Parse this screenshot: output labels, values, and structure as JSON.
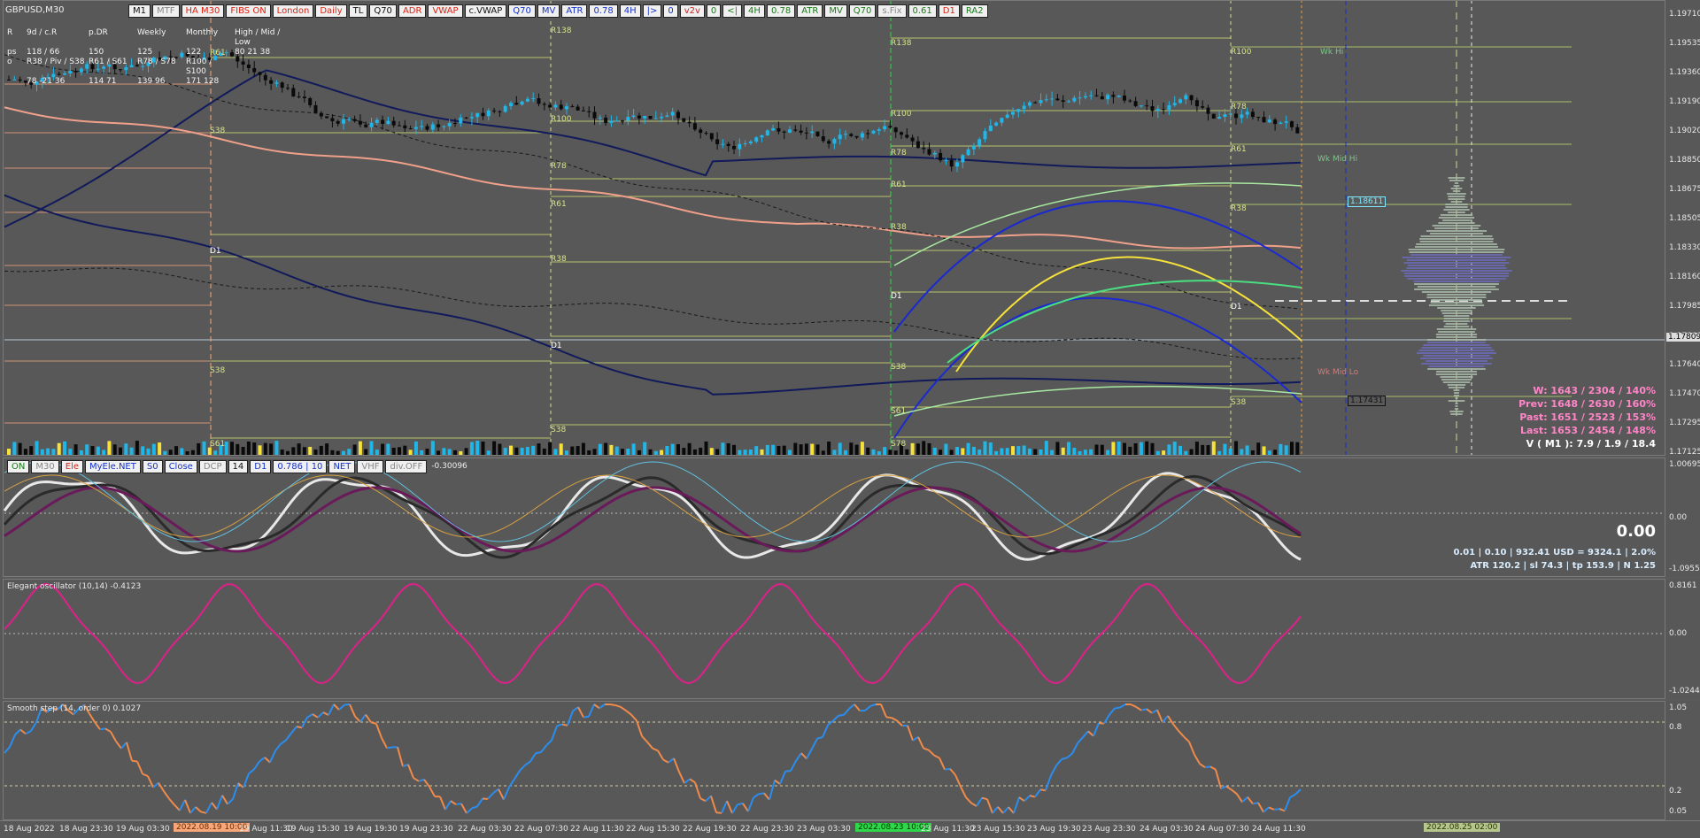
{
  "chart": {
    "symbol": "GBPUSD,M30",
    "toolbar": [
      {
        "label": "M1",
        "style": ""
      },
      {
        "label": "MTF",
        "style": "gray"
      },
      {
        "label": "HA M30",
        "style": "red"
      },
      {
        "label": "FIBS ON",
        "style": "red"
      },
      {
        "label": "London",
        "style": "red"
      },
      {
        "label": "Daily",
        "style": "red"
      },
      {
        "label": "TL",
        "style": ""
      },
      {
        "label": "Q70",
        "style": ""
      },
      {
        "label": "ADR",
        "style": "red"
      },
      {
        "label": "VWAP",
        "style": "red"
      },
      {
        "label": "c.VWAP",
        "style": ""
      },
      {
        "label": "Q70",
        "style": "blue"
      },
      {
        "label": "MV",
        "style": "blue"
      },
      {
        "label": "ATR",
        "style": "blue"
      },
      {
        "label": "0.78",
        "style": "blue"
      },
      {
        "label": "4H",
        "style": "blue"
      },
      {
        "label": "|>",
        "style": "blue"
      },
      {
        "label": "0",
        "style": "blue"
      },
      {
        "label": "v2v",
        "style": "pink"
      },
      {
        "label": "0",
        "style": "green"
      },
      {
        "label": "<|",
        "style": "green"
      },
      {
        "label": "4H",
        "style": "green"
      },
      {
        "label": "0.78",
        "style": "green"
      },
      {
        "label": "ATR",
        "style": "green"
      },
      {
        "label": "MV",
        "style": "green"
      },
      {
        "label": "Q70",
        "style": "green"
      },
      {
        "label": "s.Fix",
        "style": "gray"
      },
      {
        "label": "0.61",
        "style": "green"
      },
      {
        "label": "D1",
        "style": "red"
      },
      {
        "label": "RA2",
        "style": "green"
      }
    ],
    "stats_table": [
      [
        "R",
        "9d / c.R",
        "p.DR",
        "Weekly",
        "Monthly",
        "High / Mid / Low"
      ],
      [
        "ps",
        "118 / 66",
        "150",
        "125",
        "122",
        "80  21  38"
      ],
      [
        "o",
        "R38 / Piv / S38",
        "R61 / S61",
        "R78 / S78",
        "R100 / S100",
        ""
      ],
      [
        "",
        "78  -21  36",
        "114  71",
        "139  96",
        "171  128",
        ""
      ]
    ],
    "price_ticks": [
      "1.19710",
      "1.19535",
      "1.19360",
      "1.19190",
      "1.19020",
      "1.18850",
      "1.18675",
      "1.18505",
      "1.18330",
      "1.18160",
      "1.17985",
      "1.17809",
      "1.17640",
      "1.17470",
      "1.17295",
      "1.17125"
    ],
    "current_price": "1.17809",
    "level_tags": [
      "1.18611",
      "1.17431"
    ],
    "fib_labels_left": [
      "R61",
      "S38",
      "D1",
      "S38",
      "S61",
      "R138",
      "R100",
      "R78",
      "R61",
      "R38",
      "D1",
      "S38"
    ],
    "fib_labels_right": [
      "R138",
      "R100",
      "R78",
      "R61",
      "R38",
      "D1",
      "S38",
      "S61",
      "S78",
      "R100",
      "R78",
      "R61",
      "R38",
      "D1",
      "S38"
    ],
    "week_labels": [
      "Wk Hi",
      "Wk Mid Hi",
      "Wk Mid Lo"
    ],
    "right_stats": [
      {
        "text": "W: 1643 / 2304 / 140%",
        "color": "#ff86c8"
      },
      {
        "text": "Prev: 1648 / 2630 / 160%",
        "color": "#ff86c8"
      },
      {
        "text": "Past: 1651 / 2523 / 153%",
        "color": "#ff86c8"
      },
      {
        "text": "Last: 1653 / 2454 / 148%",
        "color": "#ff86c8"
      },
      {
        "text": "V ( M1 ): 7.9 / 1.9 / 18.4",
        "color": "#ffffff"
      }
    ]
  },
  "osc1": {
    "toolbar": [
      {
        "label": "ON",
        "style": "green"
      },
      {
        "label": "M30",
        "style": "gray"
      },
      {
        "label": "Ele",
        "style": "red"
      },
      {
        "label": "MyEle.NET",
        "style": "blue"
      },
      {
        "label": "S0",
        "style": "blue"
      },
      {
        "label": "Close",
        "style": "blue"
      },
      {
        "label": "DCP",
        "style": "gray"
      },
      {
        "label": "14",
        "style": ""
      },
      {
        "label": "D1",
        "style": "blue"
      },
      {
        "label": "0.786 | 10",
        "style": "blue"
      },
      {
        "label": "NET",
        "style": "blue"
      },
      {
        "label": "VHF",
        "style": "gray"
      },
      {
        "label": "div.OFF",
        "style": "gray"
      }
    ],
    "value": "-0.30096",
    "ticks": [
      "1.00695",
      "0.00",
      "-1.09557"
    ],
    "big_value": "0.00",
    "line1": "0.01  |  0.10  |  932.41 USD = 9324.1  |  2.0%",
    "line2": "ATR 120.2  |  sl 74.3  |  tp 153.9  |  N 1.25"
  },
  "osc2": {
    "label": "Elegant oscillator (10,14) -0.4123",
    "ticks": [
      "0.8161",
      "0.00",
      "-1.0244"
    ]
  },
  "osc3": {
    "label": "Smooth step (14, order 0) 0.1027",
    "ticks": [
      "1.05",
      "0.8",
      "0.2",
      "0.05"
    ]
  },
  "time_axis": {
    "labels": [
      "18 Aug 2022",
      "18 Aug 23:30",
      "19 Aug 03:30",
      "19 Aug 11:30",
      "19 Aug 15:30",
      "19 Aug 19:30",
      "19 Aug 23:30",
      "22 Aug 03:30",
      "22 Aug 07:30",
      "22 Aug 11:30",
      "22 Aug 15:30",
      "22 Aug 19:30",
      "22 Aug 23:30",
      "23 Aug 03:30",
      "23 Aug 11:30",
      "23 Aug 15:30",
      "23 Aug 19:30",
      "23 Aug 23:30",
      "24 Aug 03:30",
      "24 Aug 07:30",
      "24 Aug 11:30"
    ],
    "highlight_red": "2022.08.19 10:00",
    "highlight_green": "2022.08.23 10:00",
    "highlight_gray": "2022.08.25 02:00"
  }
}
